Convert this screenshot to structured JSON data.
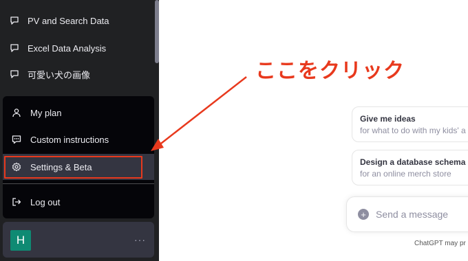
{
  "sidebar": {
    "conversations": [
      {
        "label": "PV and Search Data",
        "icon": "chat-bubble-icon"
      },
      {
        "label": "Excel Data Analysis",
        "icon": "chat-bubble-icon"
      },
      {
        "label": "可愛い犬の画像",
        "icon": "chat-bubble-icon"
      }
    ],
    "menu": {
      "my_plan": "My plan",
      "custom_instructions": "Custom instructions",
      "settings_beta": "Settings & Beta",
      "log_out": "Log out"
    },
    "user": {
      "initial": "H",
      "more": "···"
    }
  },
  "annotation": {
    "text": "ここをクリック",
    "color": "#e8391d"
  },
  "main": {
    "suggestions": [
      {
        "title": "Give me ideas",
        "subtitle": "for what to do with my kids' a"
      },
      {
        "title": "Design a database schema",
        "subtitle": "for an online merch store"
      }
    ],
    "composer": {
      "placeholder": "Send a message",
      "plus": "+"
    },
    "disclaimer": "ChatGPT may pr"
  },
  "colors": {
    "sidebar_bg": "#202123",
    "menu_bg": "#050509",
    "active_bg": "#343541",
    "avatar": "#0f8a73",
    "highlight": "#e8391d"
  }
}
